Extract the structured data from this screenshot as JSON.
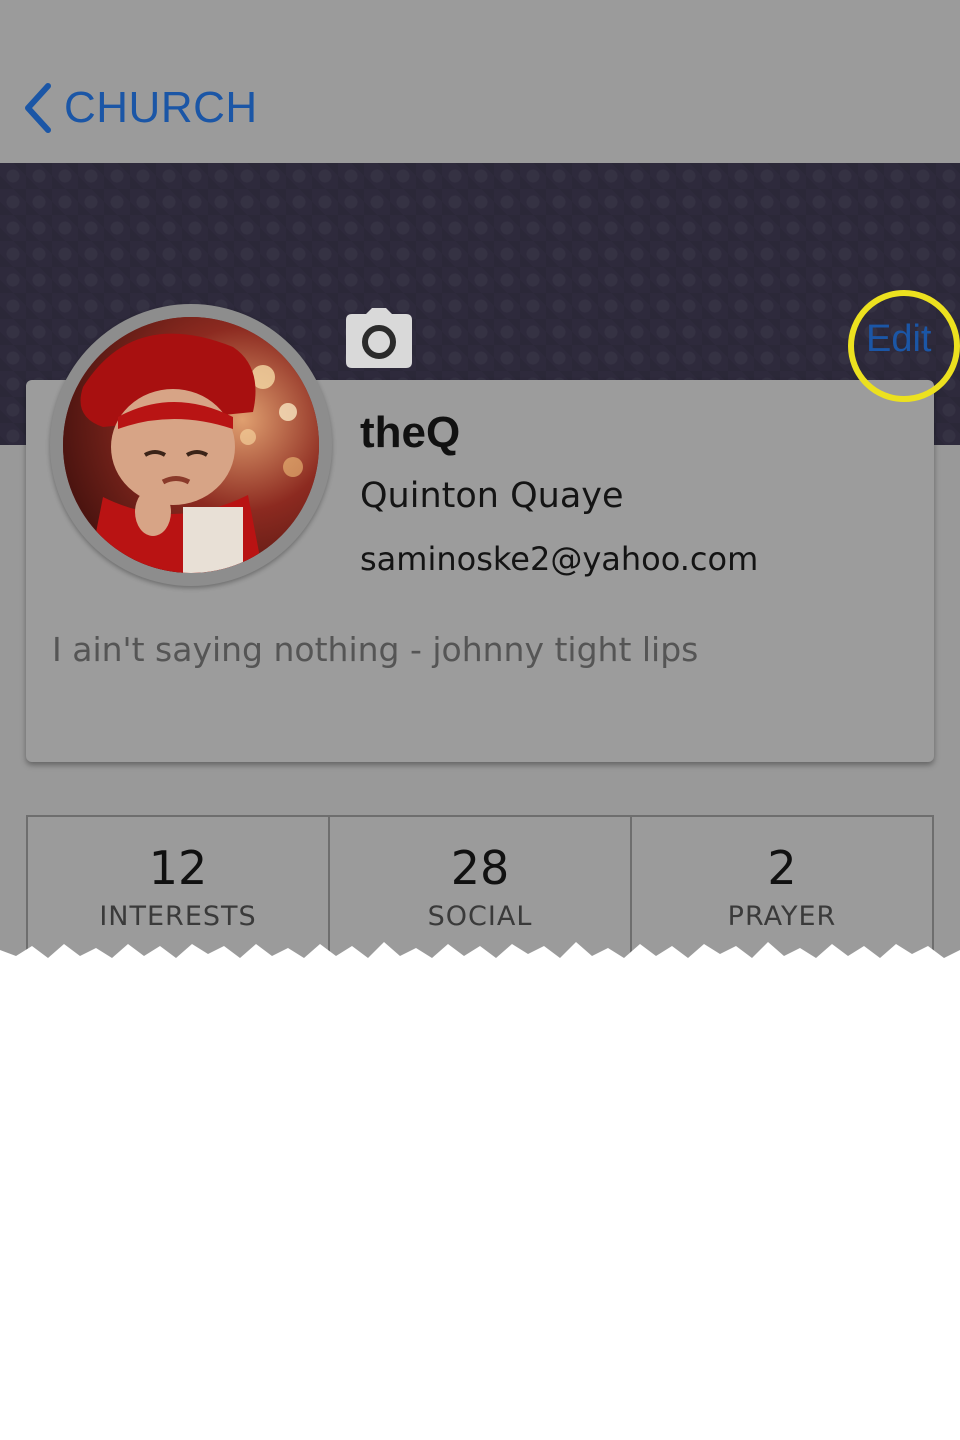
{
  "nav": {
    "back_label": "CHURCH",
    "back_icon": "chevron-left-icon"
  },
  "banner": {
    "camera_icon": "camera-icon"
  },
  "actions": {
    "edit_label": "Edit"
  },
  "profile": {
    "username": "theQ",
    "full_name": "Quinton Quaye",
    "email": "saminoske2@yahoo.com",
    "bio": "I ain't saying nothing - johnny tight lips",
    "avatar_icon": "profile-photo"
  },
  "stats": [
    {
      "value": "12",
      "label": "INTERESTS"
    },
    {
      "value": "28",
      "label": "SOCIAL"
    },
    {
      "value": "2",
      "label": "PRAYER"
    }
  ],
  "colors": {
    "accent": "#1b56a6",
    "highlight_ring": "#ece11f",
    "banner": "#2e2a3c",
    "overlay_gray": "#999999"
  }
}
